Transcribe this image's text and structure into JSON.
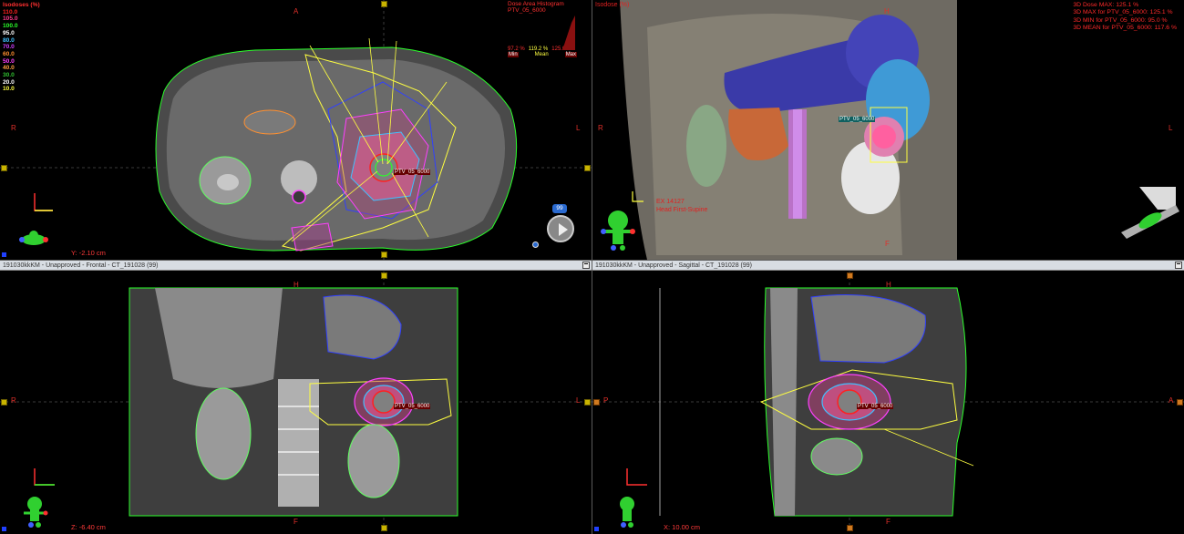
{
  "legend": {
    "title": "Isodoses (%)",
    "levels": [
      {
        "label": "110.0",
        "color": "#ff2020"
      },
      {
        "label": "105.0",
        "color": "#ff3a8a"
      },
      {
        "label": "100.0",
        "color": "#2aff2a"
      },
      {
        "label": "95.0",
        "color": "#ffffff"
      },
      {
        "label": "80.0",
        "color": "#40c0ff"
      },
      {
        "label": "70.0",
        "color": "#d040ff"
      },
      {
        "label": "60.0",
        "color": "#ff9030"
      },
      {
        "label": "50.0",
        "color": "#ff40ff"
      },
      {
        "label": "40.0",
        "color": "#ffa040"
      },
      {
        "label": "30.0",
        "color": "#30c030"
      },
      {
        "label": "20.0",
        "color": "#ffffff"
      },
      {
        "label": "10.0",
        "color": "#ffff40"
      }
    ]
  },
  "axial": {
    "orient_top": "A",
    "orient_left": "R",
    "orient_right": "L",
    "coord": "Y: -2.10 cm",
    "dvh_title": "Dose Area Histogram",
    "dvh_sub": "PTV_05_6000",
    "dvh_min_val": "97.2 %",
    "dvh_mean_val": "119.2 %",
    "dvh_max_val": "125.0 %",
    "dvh_min_label": "Min",
    "dvh_mean_label": "Mean",
    "dvh_max_label": "Max",
    "badge": "99",
    "target_label": "PTV_05_6000"
  },
  "view3d": {
    "title": "Isodose (%)",
    "orient_top": "H",
    "orient_bottom": "F",
    "orient_left": "R",
    "orient_right": "L",
    "stat1": "3D Dose MAX: 125.1 %",
    "stat2": "3D MAX for PTV_05_6000: 125.1 %",
    "stat3": "3D MIN for PTV_05_6000: 95.0 %",
    "stat4": "3D MEAN for PTV_05_6000: 117.6 %",
    "patient_label1": "EX 14127",
    "patient_label2": "Head First-Supine",
    "target_label": "PTV_05_6000"
  },
  "frontal": {
    "title": "191030kkKM - Unapproved - Frontal - CT_191028 (99)",
    "orient_top": "H",
    "orient_bottom": "F",
    "orient_left": "R",
    "orient_right": "L",
    "coord": "Z: -6.40 cm",
    "target_label": "PTV_05_6000"
  },
  "sagittal": {
    "title": "191030kkKM - Unapproved - Sagittal - CT_191028 (99)",
    "orient_top": "H",
    "orient_bottom": "F",
    "orient_left": "P",
    "orient_right": "A",
    "coord": "X: 10.00 cm",
    "target_label": "PTV_05_6000"
  }
}
